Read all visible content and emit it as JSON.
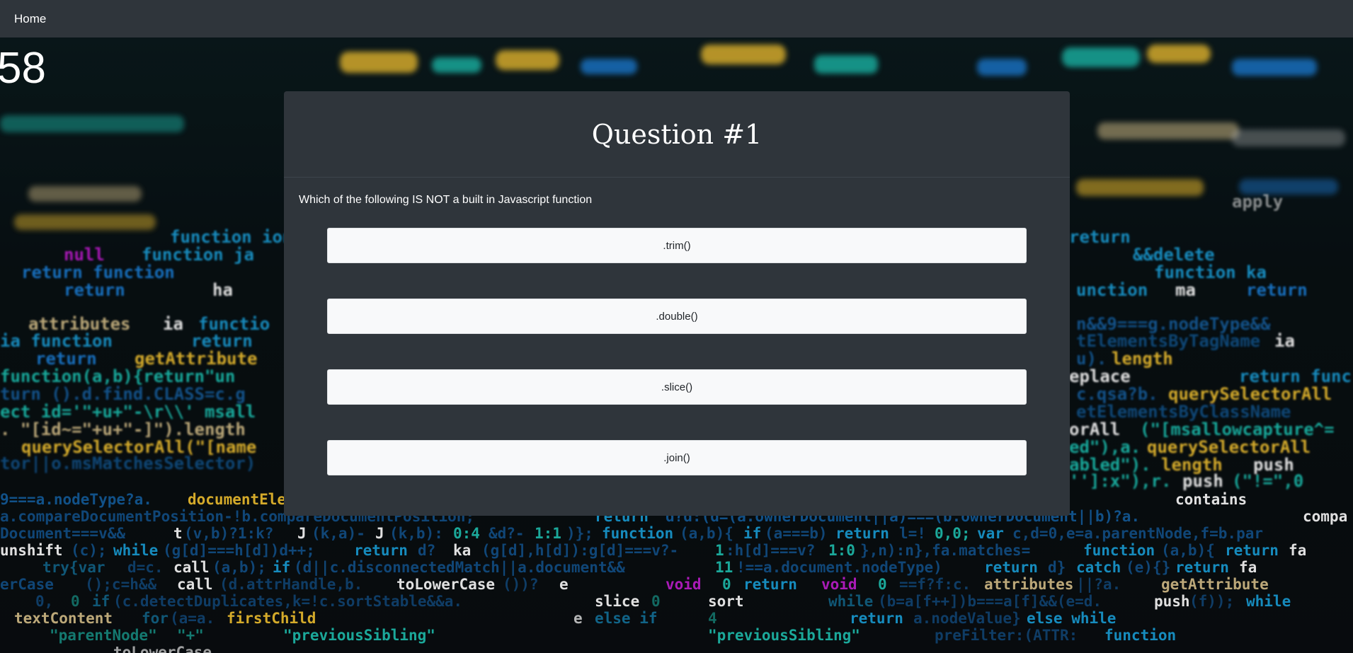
{
  "nav": {
    "home_label": "Home"
  },
  "timer": {
    "value": "58"
  },
  "question": {
    "title": "Question #1",
    "text": "Which of the following IS NOT a built in Javascript function",
    "answers": [
      ".trim()",
      ".double()",
      ".slice()",
      ".join()"
    ]
  },
  "colors": {
    "navbar": "#2f353b",
    "card": "#2f353b",
    "button": "#f8f9fa"
  }
}
